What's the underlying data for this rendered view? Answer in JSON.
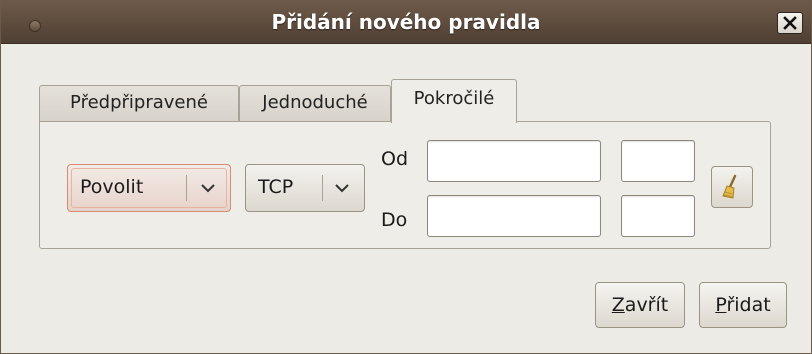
{
  "window": {
    "title": "Přidání nového pravidla"
  },
  "tabs": [
    {
      "label": "Předpřipravené",
      "active": false
    },
    {
      "label": "Jednoduché",
      "active": false
    },
    {
      "label": "Pokročilé",
      "active": true
    }
  ],
  "advanced": {
    "action": {
      "value": "Povolit"
    },
    "protocol": {
      "value": "TCP"
    },
    "from_label": "Od",
    "to_label": "Do",
    "from_address": {
      "value": "",
      "placeholder": ""
    },
    "from_port": {
      "value": "",
      "placeholder": ""
    },
    "to_address": {
      "value": "",
      "placeholder": ""
    },
    "to_port": {
      "value": "",
      "placeholder": ""
    },
    "clear_icon": "broom-icon"
  },
  "buttons": {
    "close": {
      "mnemonic": "Z",
      "rest": "avřít"
    },
    "add": {
      "mnemonic": "P",
      "rest": "řidat"
    }
  },
  "colors": {
    "titlebar": "#5e4c3e",
    "dialog_bg": "#ecebe6",
    "action_combo_border": "#d68b73"
  }
}
